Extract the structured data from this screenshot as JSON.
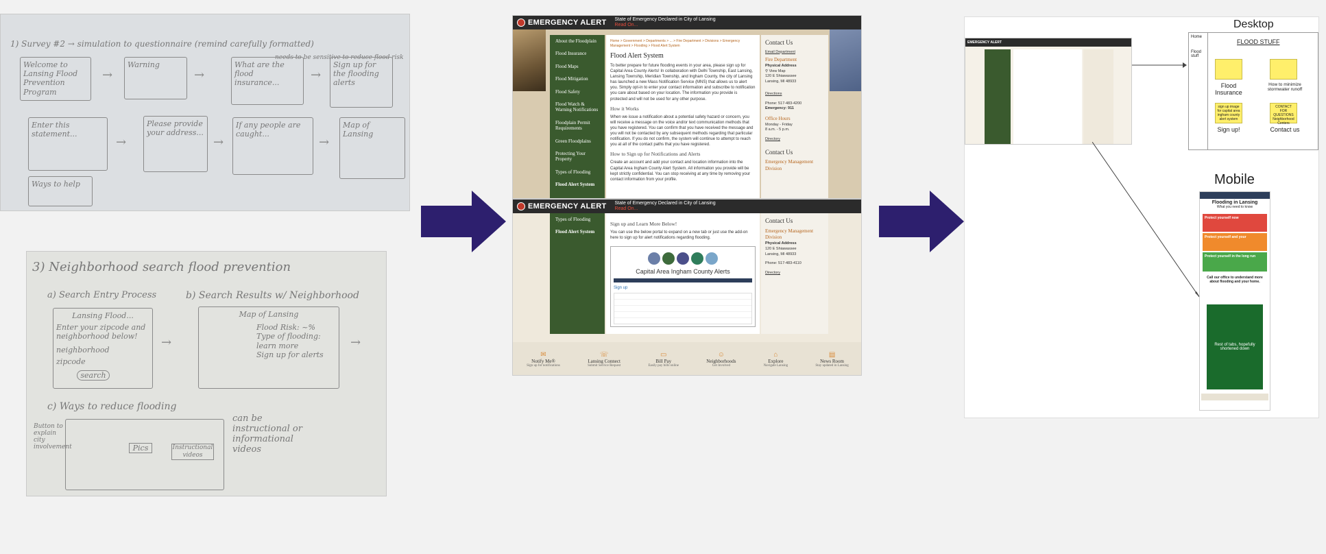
{
  "sketch1": {
    "lines": [
      "1) Survey #2 → simulation to questionnaire (remind carefully formatted)",
      "needs to be sensitive to reduce flood risk"
    ],
    "boxes": [
      "Welcome to Lansing Flood Prevention Program",
      "Warning",
      "What are the flood insurance...",
      "Sign up for the flooding alerts",
      "Enter this statement...",
      "Please provide your address...",
      "If any people are caught...",
      "Map of Lansing",
      "Ways to help"
    ]
  },
  "sketch2": {
    "title": "3) Neighborhood search flood prevention",
    "a_label": "a) Search Entry Process",
    "b_label": "b) Search Results w/ Neighborhood",
    "c_label": "c) Ways to reduce flooding",
    "box1_title": "Lansing Flood...",
    "box1_text": "Enter your zipcode and neighborhood below!",
    "box1_fields": [
      "neighborhood",
      "zipcode"
    ],
    "box1_button": "search",
    "box2_title": "Map of Lansing",
    "box2_items": [
      "Flood Risk: ~%",
      "Type of flooding:",
      "learn more",
      "Sign up for alerts"
    ],
    "c_note": "can be instructional or informational videos",
    "c_side": "Button to explain city involvement",
    "c_items": [
      "Pics",
      "Instructional videos"
    ]
  },
  "site": {
    "alert_logo": "EMERGENCY ALERT",
    "alert_msg": "State of Emergency Declared in City of Lansing",
    "alert_more": "Read On...",
    "nav": [
      "About the Floodplain",
      "Flood Insurance",
      "Flood Maps",
      "Flood Mitigation",
      "Flood Safety",
      "Flood Watch & Warning Notifications",
      "Floodplain Permit Requirements",
      "Green Floodplains",
      "Protecting Your Property",
      "Types of Flooding",
      "Flood Alert System"
    ],
    "breadcrumb": "Home > Government > Departments > ... > Fire Department > Divisions > Emergency Management > Flooding > Flood Alert System",
    "title": "Flood Alert System",
    "intro": "To better prepare for future flooding events in your area, please sign up for Capital Area County Alerts! In collaboration with Delhi Township, East Lansing, Lansing Township, Meridian Township, and Ingham County, the city of Lansing has launched a new Mass Notification Service (MNS) that allows us to alert you. Simply opt-in to enter your contact information and subscribe to notification you care about based on your location. The information you provide is protected and will not be used for any other purpose.",
    "how_title": "How it Works",
    "how_text": "When we issue a notification about a potential safety hazard or concern, you will receive a message on the voice and/or text communication methods that you have registered. You can confirm that you have received the message and you will not be contacted by any subsequent methods regarding that particular notification. If you do not confirm, the system will continue to attempt to reach you at all of the contact paths that you have registered.",
    "signup_title": "How to Sign up for Notifications and Alerts",
    "signup_text": "Create an account and add your contact and location information into the Capital Area Ingham County Alert System. All information you provide will be kept strictly confidential. You can stop receiving at any time by removing your contact information from your profile.",
    "learn_title": "Sign up and Learn More Below!",
    "learn_text": "You can use the below portal to expand on a new tab or just use the add-on here to sign up for alert notifications regarding flooding.",
    "portal_title": "Capital Area Ingham County Alerts",
    "portal_signup": "Sign up",
    "contact_title": "Contact Us",
    "email_link": "Email Department",
    "dept": "Fire Department",
    "addr_label": "Physical Address",
    "view_map": "View Map",
    "addr1": "120 E Shiawassee",
    "addr2": "Lansing, MI 48933",
    "directions": "Directions",
    "phone": "Phone: 517-483-4200",
    "emergency": "Emergency: 911",
    "hours_title": "Office Hours",
    "hours1": "Monday - Friday",
    "hours2": "8 a.m. - 5 p.m.",
    "directory": "Directory",
    "dept2": "Emergency Management Division",
    "phone2": "Phone: 517-483-4110",
    "footer": [
      {
        "title": "Notify Me®",
        "sub": "Sign up for notifications"
      },
      {
        "title": "Lansing Connect",
        "sub": "Submit Service Request"
      },
      {
        "title": "Bill Pay",
        "sub": "Easily pay bills online"
      },
      {
        "title": "Neighborhoods",
        "sub": "Get Involved"
      },
      {
        "title": "Explore",
        "sub": "Navigate Lansing"
      },
      {
        "title": "News Room",
        "sub": "Stay updated in Lansing"
      }
    ]
  },
  "final": {
    "desktop_label": "Desktop",
    "mobile_label": "Mobile",
    "desk_nav": [
      "Home",
      "Flood stuff"
    ],
    "desk_title": "FLOOD STUFF",
    "stickies": [
      {
        "note": "",
        "caption": "Flood Insurance"
      },
      {
        "note": "",
        "caption": "How to minimize stormwater runoff"
      },
      {
        "note": "sign up image for capital area ingham county alert system",
        "caption": "Sign up!"
      },
      {
        "note": "CONTACT FOR QUESTIONS Neighborhood Centers",
        "caption": "Contact us"
      }
    ],
    "mobile_title": "Flooding in Lansing",
    "mobile_subtitle": "What you need to know",
    "mobile_bands": [
      "Protect yourself now",
      "Protect yourself and your",
      "Protect yourself in the long run"
    ],
    "mobile_call": "Call our office to understand more about flooding and your home.",
    "mobile_green": "Rest of tabs, hopefully shortened down"
  },
  "colors": {
    "navy_arrow": "#2d1f6e",
    "nav_green": "#3a5a2e",
    "alert_bar": "#2b2b2b",
    "orange": "#b5651d"
  }
}
